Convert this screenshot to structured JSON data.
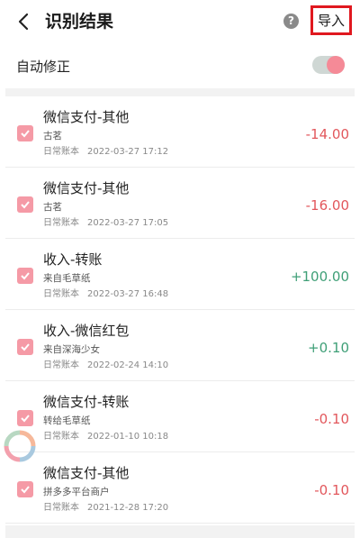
{
  "header": {
    "title": "识别结果",
    "help_symbol": "?",
    "import_label": "导入",
    "back_icon": "chevron-left-icon",
    "help_icon": "question-circle-icon"
  },
  "settings": {
    "auto_correct_label": "自动修正",
    "auto_correct_enabled": true
  },
  "colors": {
    "accent_pink": "#f59aa6",
    "expense_red": "#e2575c",
    "income_green": "#3f9f77",
    "highlight_box": "#e0181f"
  },
  "records": [
    {
      "title": "微信支付-其他",
      "subtitle": "古茗",
      "book": "日常账本",
      "datetime": "2022-03-27 17:12",
      "amount": "-14.00",
      "checked": true
    },
    {
      "title": "微信支付-其他",
      "subtitle": "古茗",
      "book": "日常账本",
      "datetime": "2022-03-27 17:05",
      "amount": "-16.00",
      "checked": true
    },
    {
      "title": "收入-转账",
      "subtitle": "来自毛草纸",
      "book": "日常账本",
      "datetime": "2022-03-27 16:48",
      "amount": "+100.00",
      "checked": true
    },
    {
      "title": "收入-微信红包",
      "subtitle": "来自深海少女",
      "book": "日常账本",
      "datetime": "2022-02-24 14:10",
      "amount": "+0.10",
      "checked": true
    },
    {
      "title": "微信支付-转账",
      "subtitle": "转给毛草纸",
      "book": "日常账本",
      "datetime": "2022-01-10 10:18",
      "amount": "-0.10",
      "checked": true
    },
    {
      "title": "微信支付-其他",
      "subtitle": "拼多多平台商户",
      "book": "日常账本",
      "datetime": "2021-12-28 17:20",
      "amount": "-0.10",
      "checked": true
    }
  ]
}
